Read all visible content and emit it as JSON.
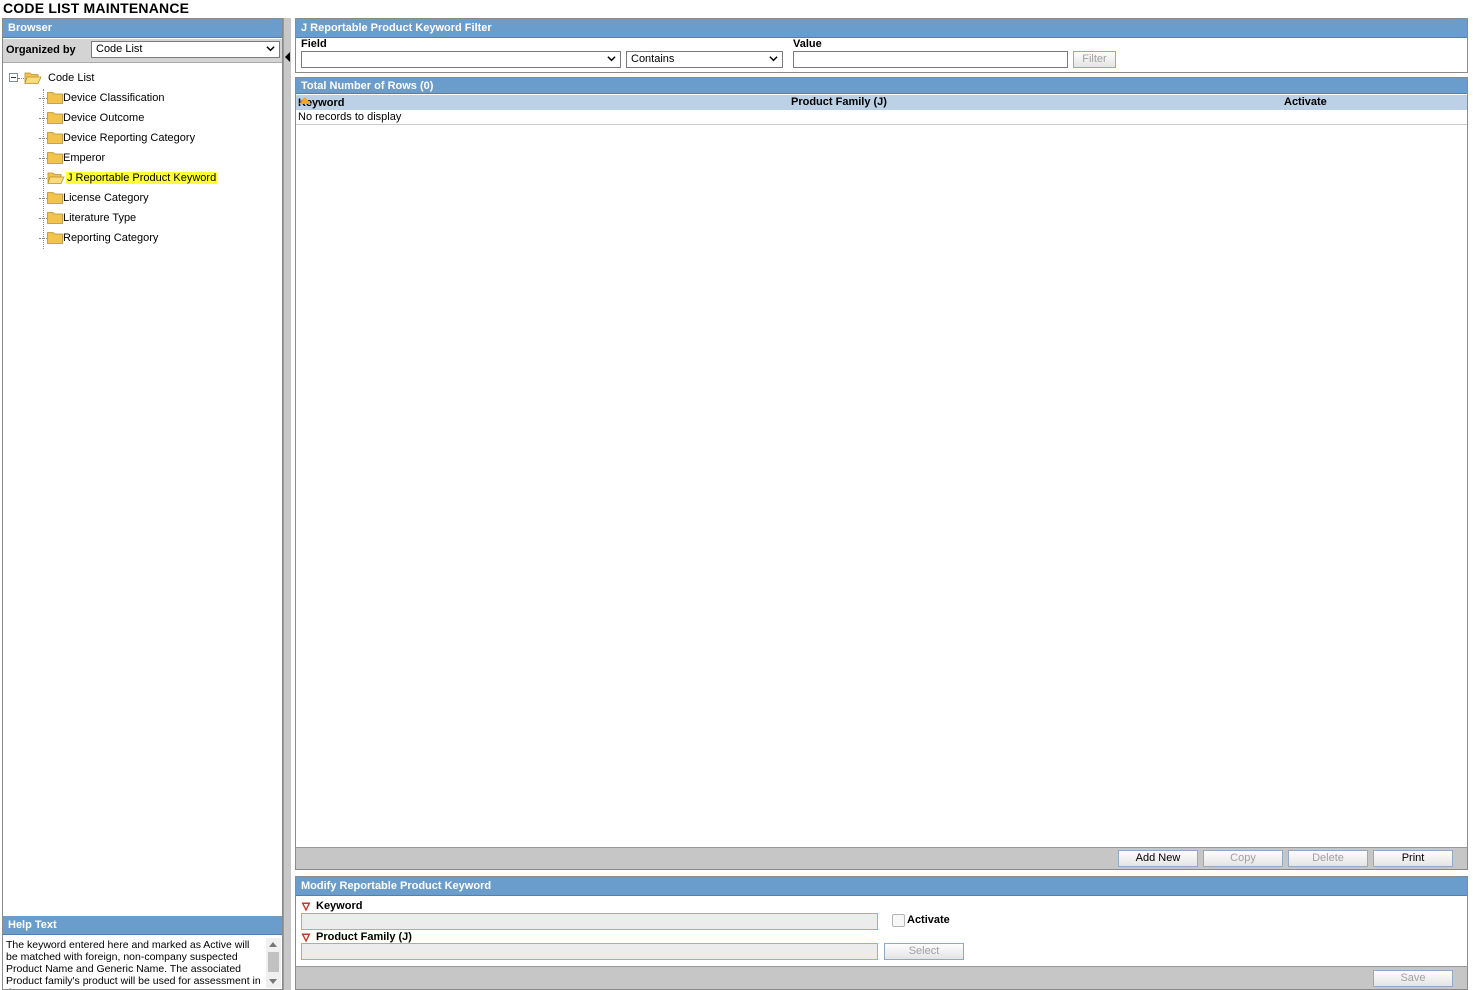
{
  "page": {
    "title": "CODE LIST MAINTENANCE"
  },
  "browser": {
    "title": "Browser",
    "organized_by_label": "Organized by",
    "organized_by_value": "Code List",
    "tree": {
      "root": "Code List",
      "items": [
        {
          "label": "Device Classification",
          "selected": false
        },
        {
          "label": "Device Outcome",
          "selected": false
        },
        {
          "label": "Device Reporting Category",
          "selected": false
        },
        {
          "label": "Emperor",
          "selected": false
        },
        {
          "label": "J Reportable Product Keyword",
          "selected": true
        },
        {
          "label": "License Category",
          "selected": false
        },
        {
          "label": "Literature Type",
          "selected": false
        },
        {
          "label": "Reporting Category",
          "selected": false
        }
      ]
    }
  },
  "help": {
    "title": "Help Text",
    "text": "The keyword entered here and marked as Active will be matched with foreign, non-company suspected Product Name and Generic Name. The associated Product family's product will be used for assessment in the PMDA report."
  },
  "filter": {
    "title": "J Reportable Product Keyword Filter",
    "field_label": "Field",
    "field_value": "",
    "operator_value": "Contains",
    "value_label": "Value",
    "value_input": "",
    "filter_button": "Filter"
  },
  "grid": {
    "title": "Total Number of Rows (0)",
    "columns": [
      "Keyword",
      "Product Family (J)",
      "Activate"
    ],
    "empty_message": "No records to display",
    "buttons": {
      "add_new": "Add New",
      "copy": "Copy",
      "delete": "Delete",
      "print": "Print"
    }
  },
  "modify": {
    "title": "Modify Reportable Product Keyword",
    "keyword_label": "Keyword",
    "keyword_value": "",
    "activate_label": "Activate",
    "product_family_label": "Product Family (J)",
    "product_family_value": "",
    "select_button": "Select",
    "save_button": "Save"
  },
  "colors": {
    "header_bar": "#6a9ccc",
    "grid_header": "#bcd1e6",
    "highlight": "#ffff33",
    "required_border": "#e8a33a"
  }
}
